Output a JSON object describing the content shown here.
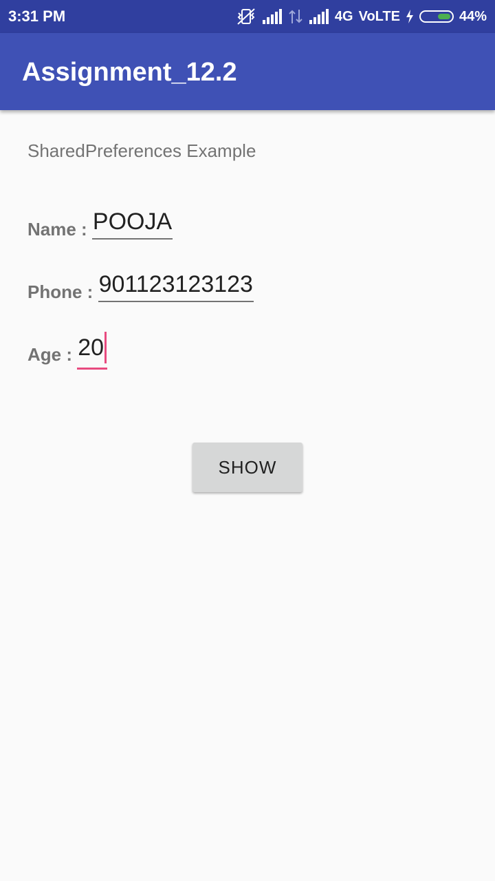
{
  "status_bar": {
    "time": "3:31 PM",
    "network": "4G",
    "volte": "VoLTE",
    "battery_percent": "44%",
    "battery_level": 0.44,
    "battery_color": "#4caf50",
    "icons": [
      "vibrate-off-icon",
      "signal-bars-icon",
      "data-transfer-icon",
      "signal-bars-icon",
      "charging-bolt-icon",
      "battery-icon"
    ]
  },
  "app_bar": {
    "title": "Assignment_12.2",
    "color": "#3f51b5"
  },
  "content": {
    "subtitle": "SharedPreferences Example",
    "fields": [
      {
        "label": "Name : ",
        "value": "POOJA"
      },
      {
        "label": "Phone : ",
        "value": "901123123123"
      },
      {
        "label": "Age : ",
        "value": "20",
        "focused": true
      }
    ],
    "show_button": "SHOW"
  },
  "accent_color": "#e84a7f"
}
